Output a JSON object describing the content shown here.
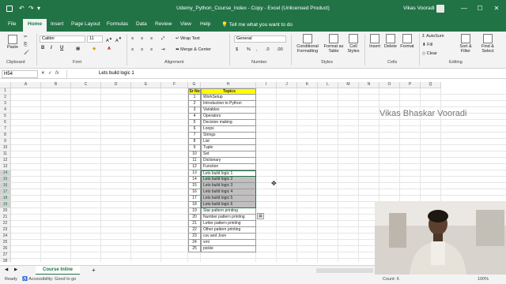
{
  "title_bar": {
    "title": "Udemy_Python_Course_Index - Copy  -  Excel (Unlicensed Product)",
    "user": "Vikas Vooradi",
    "undo_glyph": "↶",
    "redo_glyph": "↷",
    "customize_glyph": "▾",
    "minimize": "—",
    "maximize": "☐",
    "close": "✕"
  },
  "menu": {
    "tabs": [
      "File",
      "Home",
      "Insert",
      "Page Layout",
      "Formulas",
      "Data",
      "Review",
      "View",
      "Help"
    ],
    "active": "Home",
    "tell_me": "Tell me what you want to do"
  },
  "ribbon": {
    "clipboard": {
      "group": "Clipboard",
      "paste": "Paste"
    },
    "font": {
      "group": "Font",
      "name": "Calibri",
      "size": "11"
    },
    "alignment": {
      "group": "Alignment",
      "wrap_text": "Wrap Text",
      "merge_center": "Merge & Center"
    },
    "number": {
      "group": "Number",
      "format": "General",
      "currency": "$",
      "percent": "%",
      "comma": ","
    },
    "styles": {
      "group": "Styles",
      "conditional": "Conditional Formatting",
      "format_table": "Format as Table",
      "cell_styles": "Cell Styles"
    },
    "cells": {
      "group": "Cells",
      "insert": "Insert",
      "delete": "Delete",
      "format": "Format"
    },
    "editing": {
      "group": "Editing",
      "autosum": "AutoSum",
      "fill": "Fill",
      "clear": "Clear",
      "sort_filter": "Sort & Filter",
      "find_select": "Find & Select"
    }
  },
  "formula_bar": {
    "name_box": "H54",
    "fx": "fx",
    "value": "Lets build logic 1"
  },
  "columns": [
    "A",
    "B",
    "C",
    "D",
    "E",
    "F",
    "G",
    "H",
    "I",
    "J",
    "K",
    "L",
    "M",
    "N",
    "O",
    "P",
    "Q"
  ],
  "rows": [
    "1",
    "2",
    "3",
    "4",
    "5",
    "6",
    "7",
    "8",
    "9",
    "10",
    "11",
    "12",
    "13",
    "14",
    "15",
    "16",
    "17",
    "18",
    "19",
    "20",
    "21",
    "22",
    "23",
    "24",
    "25",
    "26",
    "27",
    "28"
  ],
  "table": {
    "header_num": "Sr No",
    "header_topic": "Topics",
    "rows": [
      {
        "n": "1",
        "t": "WorkSetup"
      },
      {
        "n": "2",
        "t": "Introduction to Python"
      },
      {
        "n": "3",
        "t": "Variables"
      },
      {
        "n": "4",
        "t": "Operators"
      },
      {
        "n": "5",
        "t": "Decision making"
      },
      {
        "n": "6",
        "t": "Loops"
      },
      {
        "n": "7",
        "t": "Strings"
      },
      {
        "n": "8",
        "t": "List"
      },
      {
        "n": "9",
        "t": "Tuple"
      },
      {
        "n": "10",
        "t": "Set"
      },
      {
        "n": "11",
        "t": "Dictionary"
      },
      {
        "n": "12",
        "t": "Function"
      },
      {
        "n": "13",
        "t": "Lets build logic 1"
      },
      {
        "n": "14",
        "t": "Lets build logic 2"
      },
      {
        "n": "15",
        "t": "Lets build logic 3"
      },
      {
        "n": "16",
        "t": "Lets build logic 4"
      },
      {
        "n": "17",
        "t": "Lets build logic 5"
      },
      {
        "n": "18",
        "t": "Lets build logic 6"
      },
      {
        "n": "19",
        "t": "Star pattern printing"
      },
      {
        "n": "20",
        "t": "Number pattern printing"
      },
      {
        "n": "21",
        "t": "Letter pattern printing"
      },
      {
        "n": "22",
        "t": "Other pattern printing"
      },
      {
        "n": "23",
        "t": "csv and Json"
      },
      {
        "n": "24",
        "t": "xml"
      },
      {
        "n": "25",
        "t": "pickle"
      }
    ]
  },
  "watermark": "Vikas Bhaskar Vooradi",
  "sheet_tab": "Course Inline",
  "add_sheet": "+",
  "status": {
    "ready": "Ready",
    "accessibility": "Accessibility: Good to go",
    "count": "Count: 6",
    "zoom": "100%"
  },
  "colors": {
    "excel_green": "#217346",
    "header_yellow": "#ffff00",
    "selection_gray": "#bfbfbf"
  }
}
